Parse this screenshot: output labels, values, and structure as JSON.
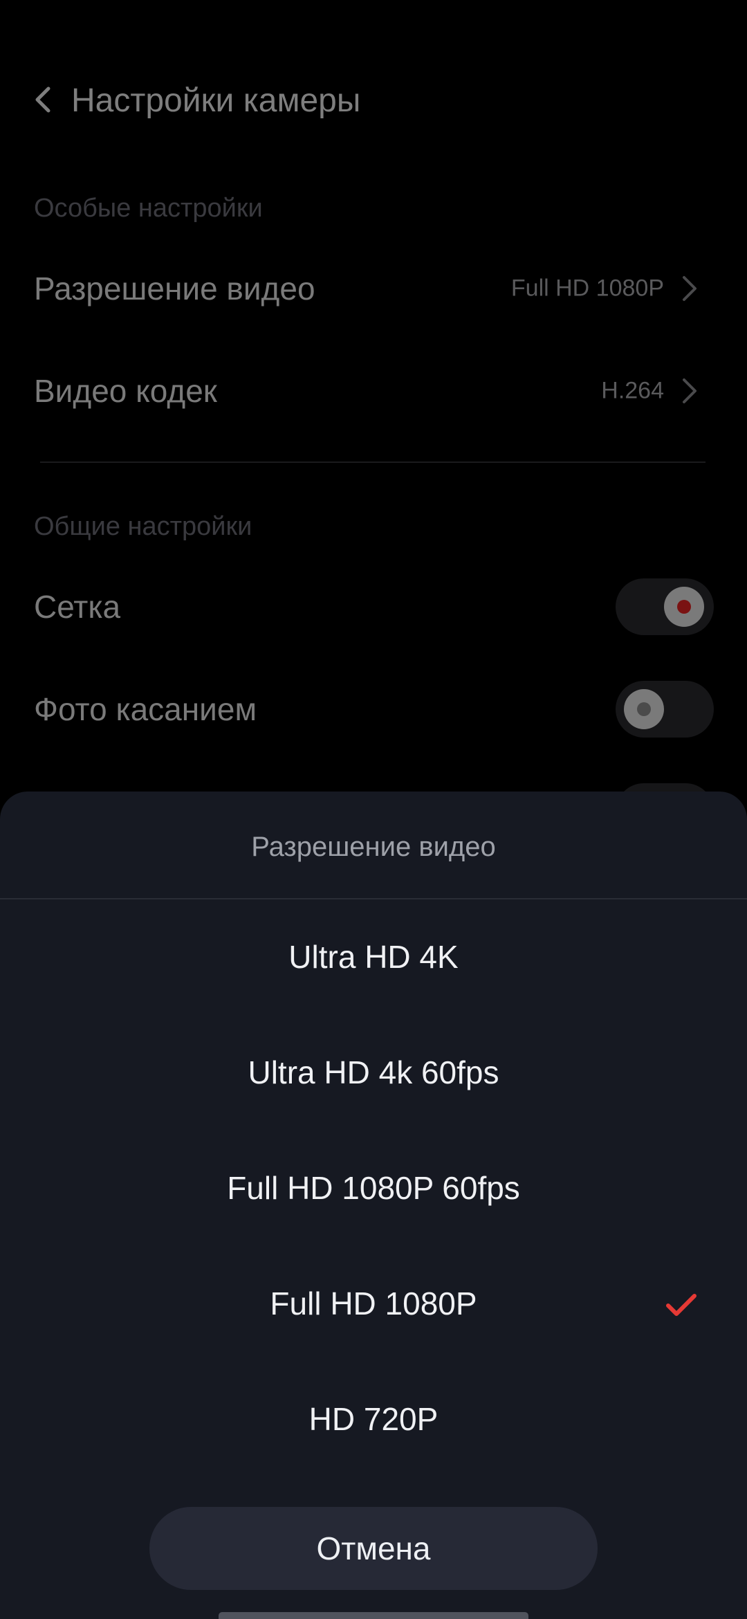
{
  "header": {
    "title": "Настройки камеры",
    "back_icon": "chevron-left-icon"
  },
  "sections": {
    "special_title": "Особые настройки",
    "general_title": "Общие настройки"
  },
  "special_settings": [
    {
      "label": "Разрешение видео",
      "value": "Full HD 1080P"
    },
    {
      "label": "Видео кодек",
      "value": "H.264"
    }
  ],
  "general_settings": [
    {
      "label": "Сетка",
      "toggle": true
    },
    {
      "label": "Фото касанием",
      "toggle": false
    }
  ],
  "sheet": {
    "title": "Разрешение видео",
    "options": [
      {
        "label": "Ultra HD 4K",
        "selected": false
      },
      {
        "label": "Ultra HD 4k 60fps",
        "selected": false
      },
      {
        "label": "Full HD 1080P 60fps",
        "selected": false
      },
      {
        "label": "Full HD 1080P",
        "selected": true
      },
      {
        "label": "HD 720P",
        "selected": false
      }
    ],
    "cancel_label": "Отмена",
    "check_icon": "checkmark-icon"
  },
  "colors": {
    "accent": "#e53935",
    "sheet_background": "#161922",
    "cancel_button": "#262936",
    "page_background": "#000000"
  }
}
